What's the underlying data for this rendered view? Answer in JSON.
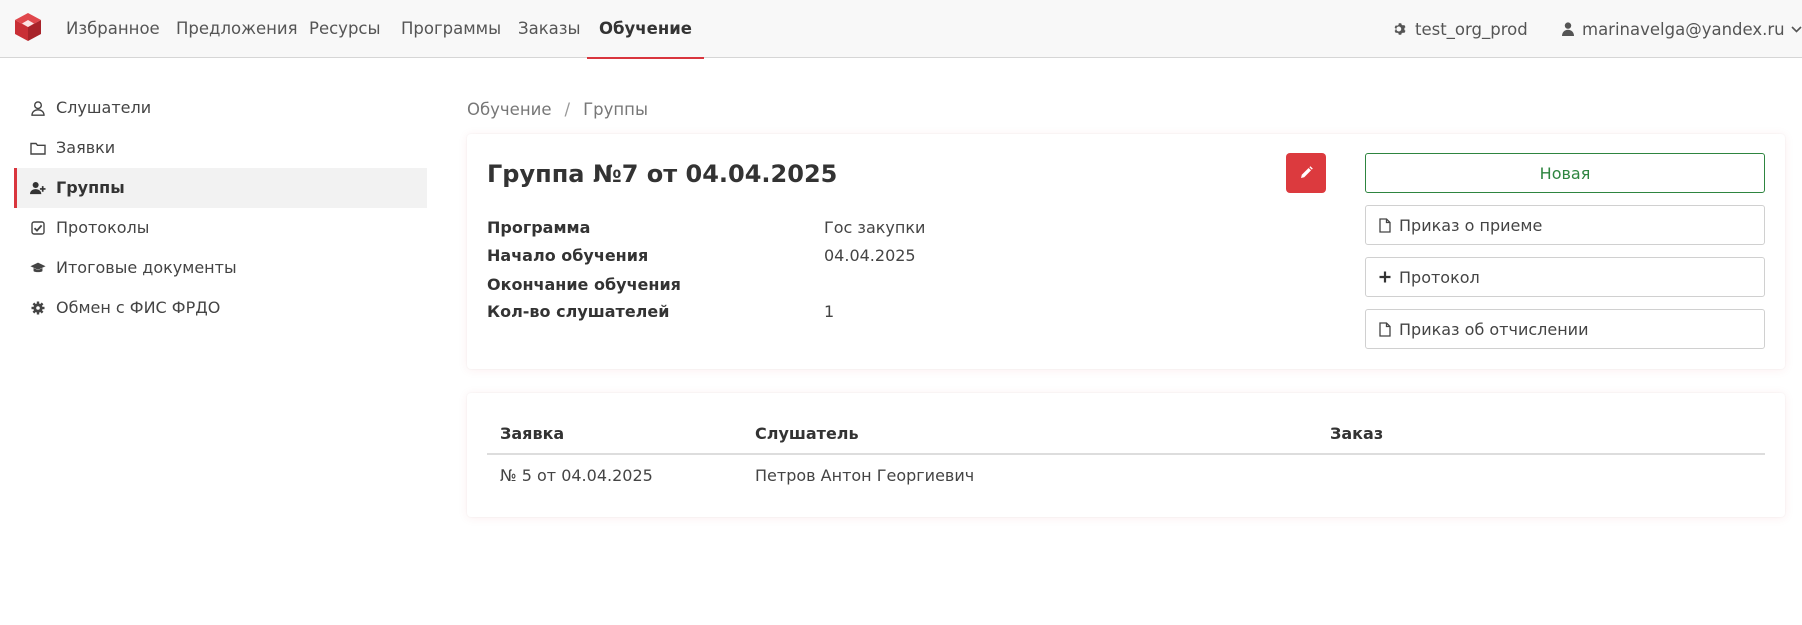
{
  "nav": {
    "items": [
      {
        "label": "Избранное"
      },
      {
        "label": "Предложения"
      },
      {
        "label": "Ресурсы"
      },
      {
        "label": "Программы"
      },
      {
        "label": "Заказы"
      },
      {
        "label": "Обучение"
      }
    ],
    "active": "Обучение",
    "org": "test_org_prod",
    "user": "marinavelga@yandex.ru"
  },
  "sidebar": {
    "items": [
      {
        "label": "Слушатели",
        "icon": "user-icon"
      },
      {
        "label": "Заявки",
        "icon": "folder-icon"
      },
      {
        "label": "Группы",
        "icon": "user-plus-icon"
      },
      {
        "label": "Протоколы",
        "icon": "check-square-icon"
      },
      {
        "label": "Итоговые документы",
        "icon": "graduation-cap-icon"
      },
      {
        "label": "Обмен с ФИС ФРДО",
        "icon": "gear-icon"
      }
    ],
    "active": "Группы"
  },
  "breadcrumb": {
    "items": [
      "Обучение",
      "Группы"
    ],
    "separator": "/"
  },
  "group": {
    "title": "Группа №7 от 04.04.2025",
    "fields": [
      {
        "label": "Программа",
        "value": "Гос закупки"
      },
      {
        "label": "Начало обучения",
        "value": "04.04.2025"
      },
      {
        "label": "Окончание обучения",
        "value": ""
      },
      {
        "label": "Кол-во слушателей",
        "value": "1"
      }
    ],
    "status": "Новая",
    "actions": [
      {
        "label": "Приказ о приеме",
        "icon": "file-icon"
      },
      {
        "label": "Протокол",
        "icon": "plus-icon"
      },
      {
        "label": "Приказ об отчислении",
        "icon": "file-icon"
      }
    ]
  },
  "table": {
    "columns": [
      "Заявка",
      "Слушатель",
      "Заказ"
    ],
    "rows": [
      {
        "application": "№ 5 от 04.04.2025",
        "student": "Петров Антон Георгиевич",
        "order": ""
      }
    ]
  },
  "colors": {
    "accent": "#d9363e",
    "edit_button": "#dc3a3e",
    "status_green": "#2e8540"
  }
}
